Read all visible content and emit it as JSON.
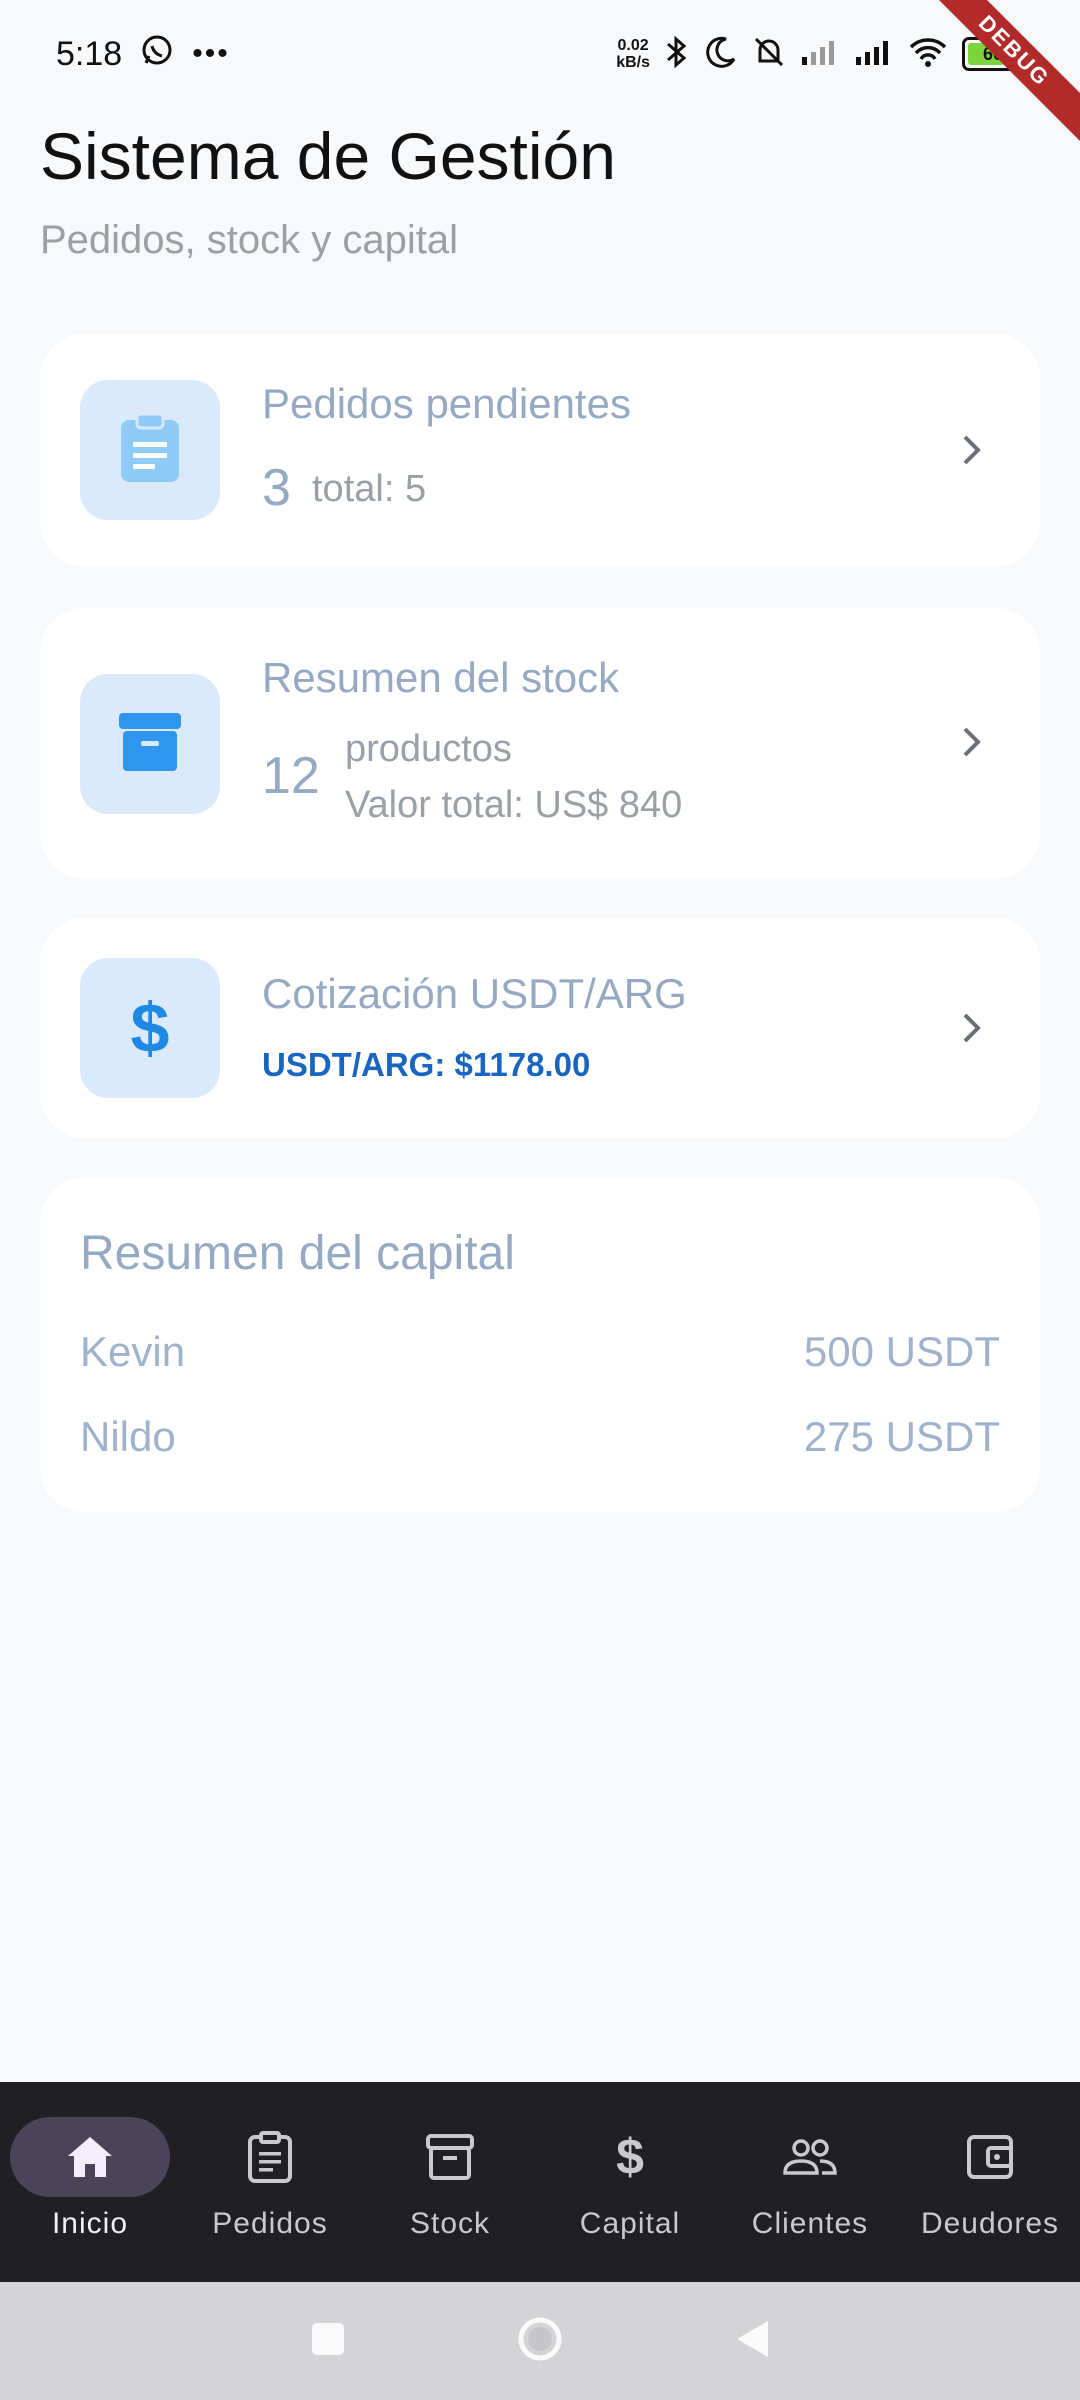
{
  "status": {
    "time": "5:18",
    "net_speed_top": "0.02",
    "net_speed_bottom": "kB/s",
    "battery": "60"
  },
  "debug_label": "DEBUG",
  "header": {
    "title": "Sistema de Gestión",
    "subtitle": "Pedidos, stock y capital"
  },
  "pedidos_card": {
    "title": "Pedidos pendientes",
    "count": "3",
    "total": "total: 5"
  },
  "stock_card": {
    "title": "Resumen del stock",
    "count": "12",
    "products_label": "productos",
    "value": "Valor total: US$ 840"
  },
  "cotizacion_card": {
    "title": "Cotización USDT/ARG",
    "rate": "USDT/ARG: $1178.00"
  },
  "capital_card": {
    "title": "Resumen del capital",
    "rows": [
      {
        "name": "Kevin",
        "amount": "500 USDT"
      },
      {
        "name": "Nildo",
        "amount": "275 USDT"
      }
    ]
  },
  "nav": {
    "items": [
      {
        "label": "Inicio",
        "icon": "home-icon",
        "active": true
      },
      {
        "label": "Pedidos",
        "icon": "clipboard-icon"
      },
      {
        "label": "Stock",
        "icon": "archive-box-icon"
      },
      {
        "label": "Capital",
        "icon": "dollar-icon"
      },
      {
        "label": "Clientes",
        "icon": "people-icon"
      },
      {
        "label": "Deudores",
        "icon": "wallet-icon"
      }
    ]
  },
  "colors": {
    "accent": "#2196f3",
    "rate_text": "#1866c2",
    "nav_bg": "#1f1f24"
  }
}
